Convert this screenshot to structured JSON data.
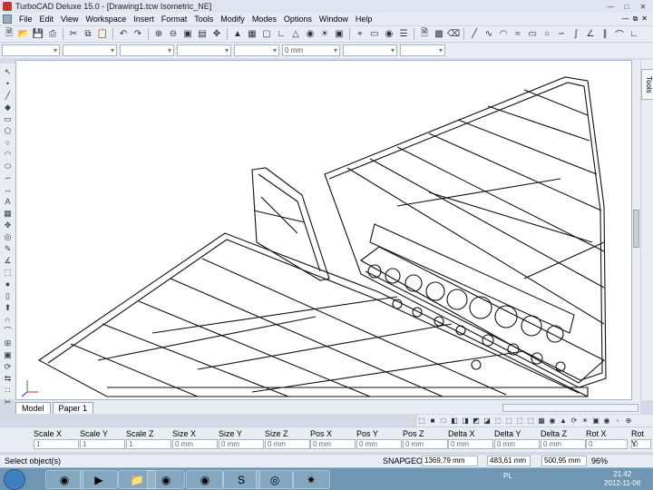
{
  "window": {
    "title": "TurboCAD Deluxe 15.0 - [Drawing1.tcw Isometric_NE]",
    "controls": [
      "minimize",
      "maximize",
      "close"
    ]
  },
  "menu": {
    "items": [
      "File",
      "Edit",
      "View",
      "Workspace",
      "Insert",
      "Format",
      "Tools",
      "Modify",
      "Modes",
      "Options",
      "Window",
      "Help"
    ]
  },
  "toolbar2": {
    "thickness_value": "0 mm"
  },
  "tabs": {
    "model": "Model",
    "paper": "Paper 1"
  },
  "right_panel": {
    "tab_label": "Tools"
  },
  "inspector": {
    "fields": [
      {
        "label": "Scale X",
        "value": "1"
      },
      {
        "label": "Scale Y",
        "value": "1"
      },
      {
        "label": "Scale Z",
        "value": "1"
      },
      {
        "label": "Size X",
        "value": "0 mm"
      },
      {
        "label": "Size Y",
        "value": "0 mm"
      },
      {
        "label": "Size Z",
        "value": "0 mm"
      },
      {
        "label": "Pos X",
        "value": "0 mm"
      },
      {
        "label": "Pos Y",
        "value": "0 mm"
      },
      {
        "label": "Pos Z",
        "value": "0 mm"
      },
      {
        "label": "Delta X",
        "value": "0 mm"
      },
      {
        "label": "Delta Y",
        "value": "0 mm"
      },
      {
        "label": "Delta Z",
        "value": "0 mm"
      },
      {
        "label": "Rot X",
        "value": "0"
      },
      {
        "label": "Rot Y",
        "value": "0"
      }
    ]
  },
  "status": {
    "message": "Select object(s)",
    "snap": "SNAP",
    "geo": "GEO",
    "coord_x": "1369,79 mm",
    "coord_y": "483,61 mm",
    "coord_z": "500,95 mm",
    "zoom": "96%"
  },
  "taskbar": {
    "lang": "PL",
    "time": "21:42",
    "date": "2012-11-06"
  }
}
